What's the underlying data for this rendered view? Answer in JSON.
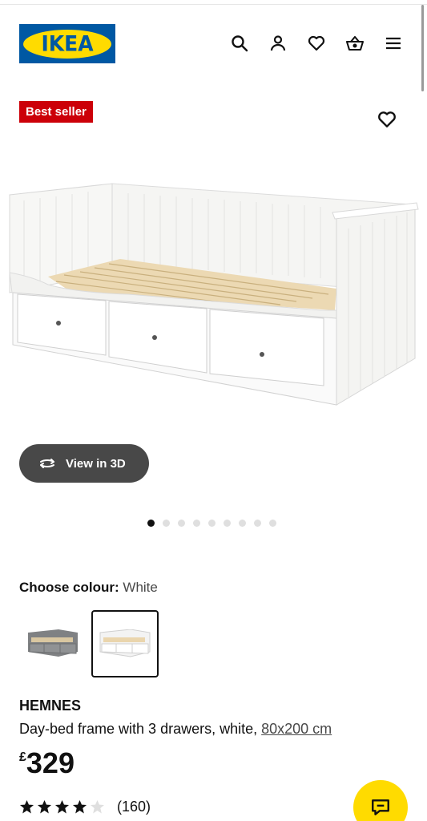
{
  "header": {
    "logo_text": "IKEA",
    "icons": [
      "search-icon",
      "user-icon",
      "heart-icon",
      "basket-icon",
      "menu-icon"
    ]
  },
  "product": {
    "badge": "Best seller",
    "view3d_label": "View in 3D",
    "image_count": 9,
    "active_image_index": 0,
    "colour_label": "Choose colour:",
    "colour_value": "White",
    "colour_options": [
      "Grey",
      "White"
    ],
    "selected_colour_index": 1,
    "name": "HEMNES",
    "description": "Day-bed frame with 3 drawers, white, ",
    "size_link": "80x200 cm",
    "price_currency": "£",
    "price_value": "329",
    "rating": 4,
    "rating_max": 5,
    "review_count": "(160)"
  },
  "colors": {
    "ikea_blue": "#0058a3",
    "ikea_yellow": "#ffdb00",
    "badge_red": "#cc0008",
    "button_dark": "#484848"
  }
}
